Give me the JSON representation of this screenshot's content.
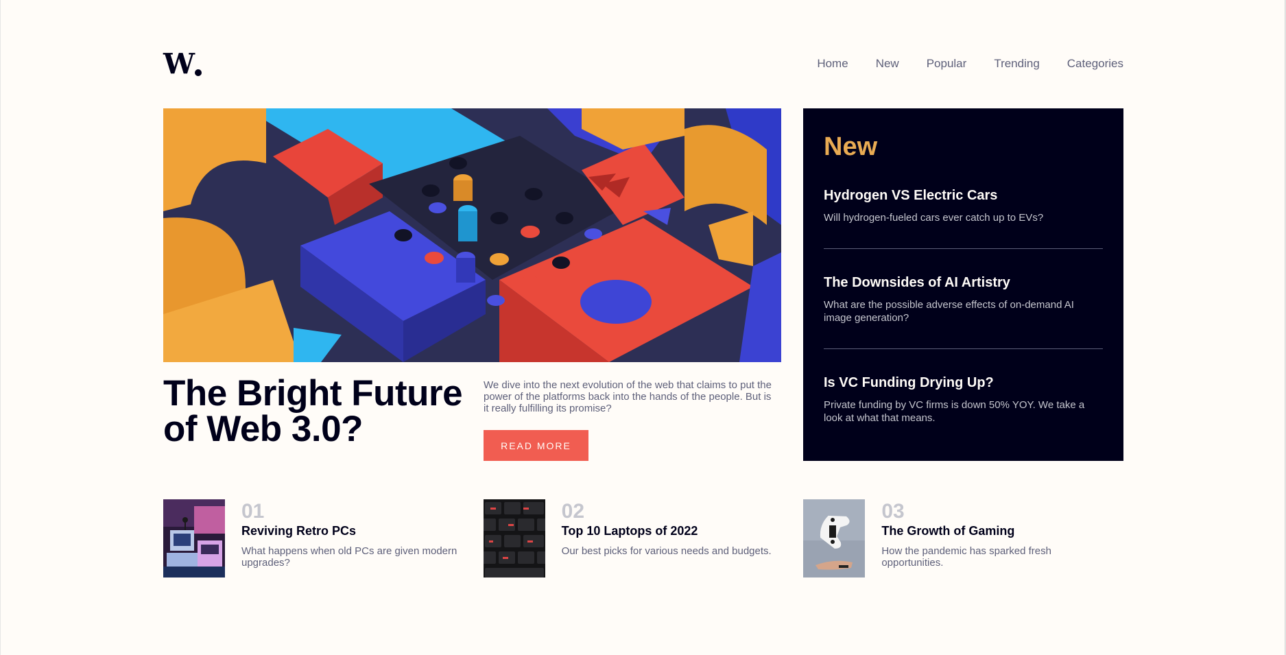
{
  "brand": {
    "logo": "W"
  },
  "nav": {
    "items": [
      "Home",
      "New",
      "Popular",
      "Trending",
      "Categories"
    ]
  },
  "hero": {
    "title": "The Bright Future of Web 3.0?",
    "description": "We dive into the next evolution of the web that claims to put the power of the platforms back into the hands of the people. But is it really fulfilling its promise?",
    "button": "READ MORE"
  },
  "new_panel": {
    "heading": "New",
    "items": [
      {
        "title": "Hydrogen VS Electric Cars",
        "desc": "Will hydrogen-fueled cars ever catch up to EVs?"
      },
      {
        "title": "The Downsides of AI Artistry",
        "desc": "What are the possible adverse effects of on-demand AI image generation?"
      },
      {
        "title": "Is VC Funding Drying Up?",
        "desc": "Private funding by VC firms is down 50% YOY. We take a look at what that means."
      }
    ]
  },
  "articles": [
    {
      "num": "01",
      "title": "Reviving Retro PCs",
      "desc": "What happens when old PCs are given modern upgrades?"
    },
    {
      "num": "02",
      "title": "Top 10 Laptops of 2022",
      "desc": "Our best picks for various needs and budgets."
    },
    {
      "num": "03",
      "title": "The Growth of Gaming",
      "desc": "How the pandemic has sparked fresh opportunities."
    }
  ],
  "colors": {
    "background": "#fffcf8",
    "dark": "#00001a",
    "accent": "#f15d51",
    "orange": "#e9ab53",
    "muted": "#5d5f79",
    "light_muted": "#c5c6ce"
  }
}
